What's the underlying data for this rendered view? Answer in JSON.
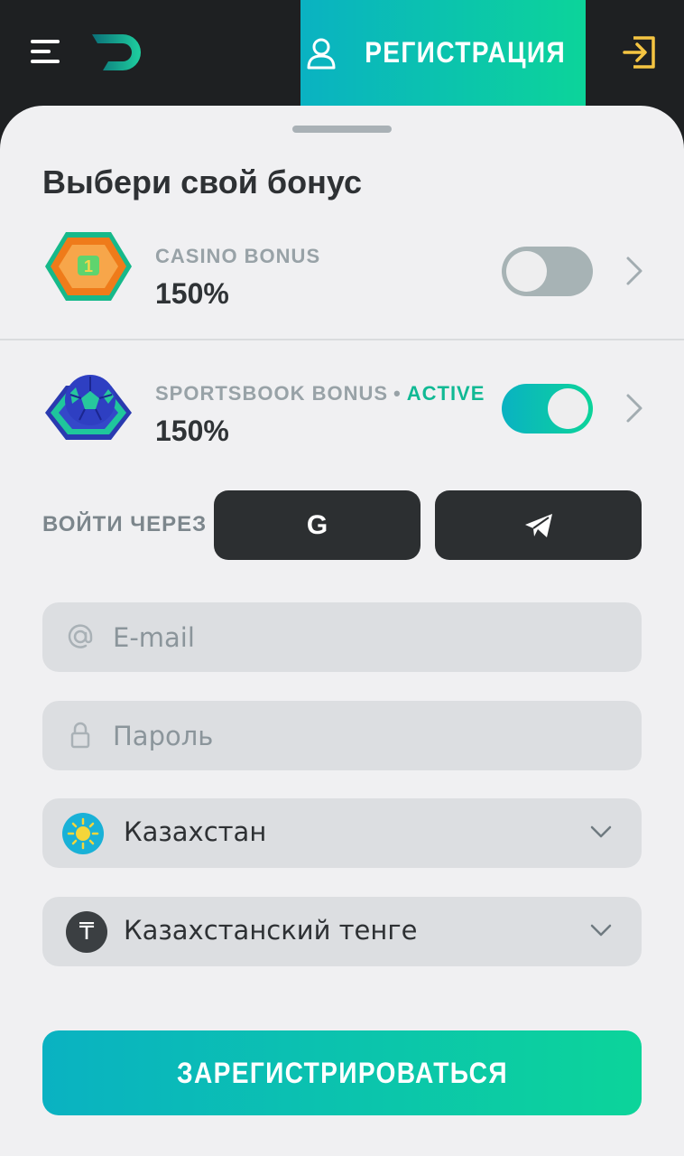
{
  "header": {
    "register_tab": "РЕГИСТРАЦИЯ",
    "icons": {
      "menu": "hamburger-menu-icon",
      "logo": "brand-logo",
      "user": "user-icon",
      "login": "login-icon"
    }
  },
  "sheet": {
    "title": "Выбери свой бонус",
    "bonuses": [
      {
        "name": "CASINO BONUS",
        "status": "",
        "percent": "150%",
        "enabled": false,
        "icon": "casino-bonus-icon"
      },
      {
        "name": "SPORTSBOOK BONUS",
        "status": "ACTIVE",
        "percent": "150%",
        "enabled": true,
        "icon": "sportsbook-bonus-icon"
      }
    ],
    "login_via": {
      "label": "ВОЙТИ ЧЕРЕЗ",
      "google_glyph": "G",
      "icons": {
        "google": "google-icon",
        "telegram": "telegram-icon"
      }
    },
    "form": {
      "email_placeholder": "E-mail",
      "password_placeholder": "Пароль",
      "country": "Казахстан",
      "currency": "Казахстанский тенге",
      "currency_symbol": "₸",
      "submit_label": "ЗАРЕГИСТРИРОВАТЬСЯ"
    }
  },
  "colors": {
    "accent_start": "#0ab2c2",
    "accent_end": "#0cd49a",
    "active_text": "#10b994",
    "header_bg": "#1e2022",
    "sheet_bg": "#f0f0f2",
    "login_icon": "#f5c542"
  }
}
